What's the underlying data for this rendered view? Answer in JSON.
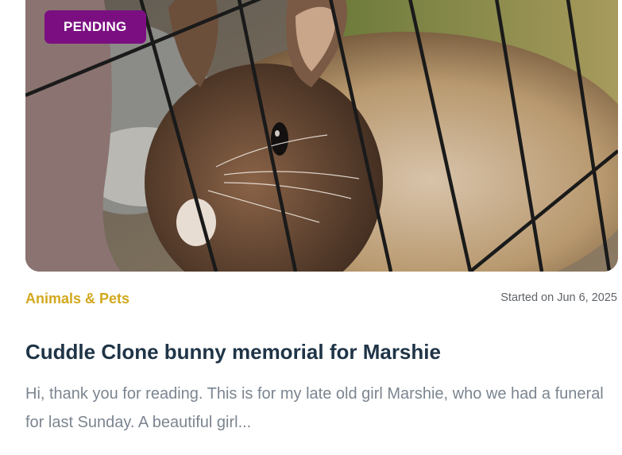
{
  "campaign": {
    "status_badge": "PENDING",
    "category": "Animals & Pets",
    "started": "Started on Jun 6, 2025",
    "title": "Cuddle Clone bunny memorial for Marshie",
    "excerpt": "Hi, thank you for reading. This is for my late old girl Marshie, who we had a funeral for last Sunday. A beautiful girl...",
    "colors": {
      "badge": "#7b0f82",
      "category": "#d3a81c",
      "title": "#1f3447",
      "excerpt": "#7b8590"
    }
  }
}
